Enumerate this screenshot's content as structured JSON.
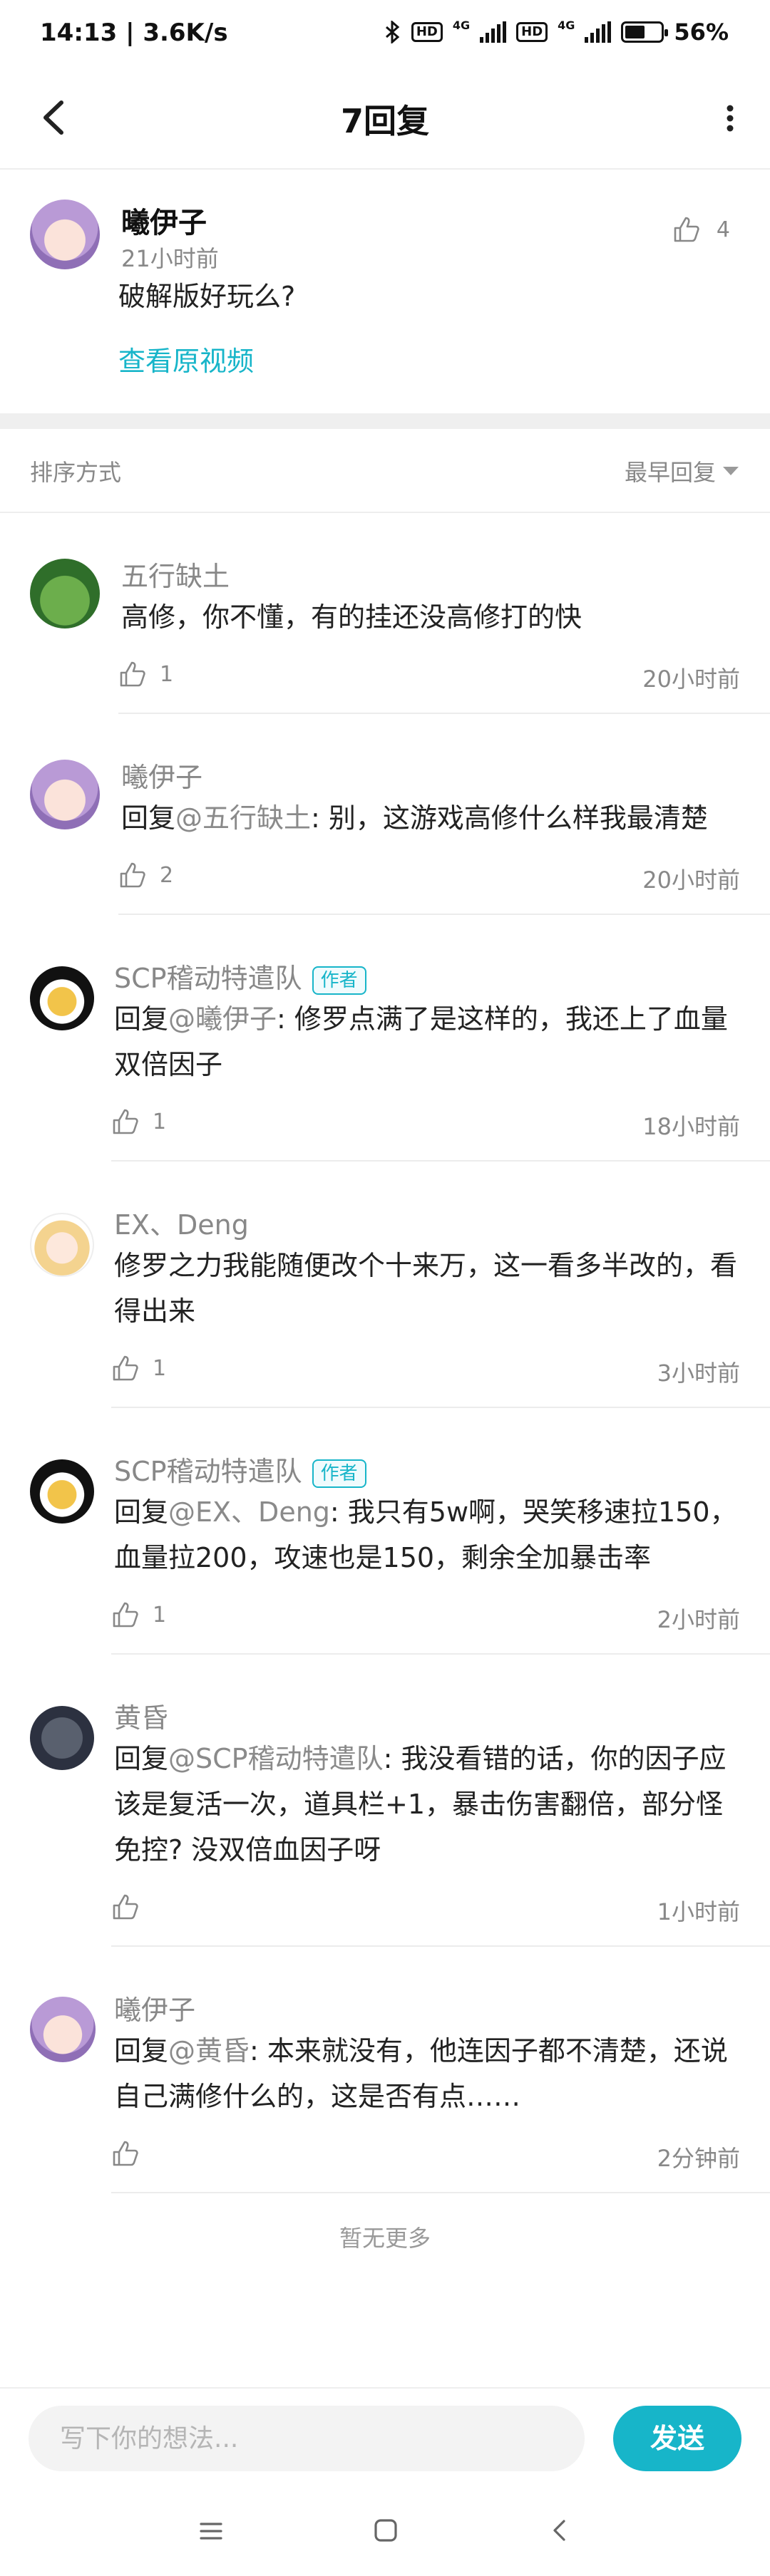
{
  "status_bar": {
    "time": "14:13 | 3.6K/s",
    "battery": "56%",
    "battery_level": 0.56,
    "network_1": "4G",
    "network_2": "4G",
    "hd": "HD"
  },
  "header": {
    "title": "7回复"
  },
  "root_comment": {
    "user": "曦伊子",
    "time": "21小时前",
    "content": "破解版好玩么?",
    "likes": "4",
    "view_video": "查看原视频"
  },
  "sort": {
    "label": "排序方式",
    "selected": "最早回复"
  },
  "replies": [
    {
      "user": "五行缺土",
      "content": "高修，你不懂，有的挂还没高修打的快",
      "likes": "1",
      "time": "20小时前"
    },
    {
      "user": "曦伊子",
      "prefix": "回复",
      "mention": "@五行缺土",
      "content": ": 别，这游戏高修什么样我最清楚",
      "likes": "2",
      "time": "20小时前"
    },
    {
      "user": "SCP稽动特遣队",
      "badge": "作者",
      "prefix": "回复",
      "mention": "@曦伊子",
      "content": ": 修罗点满了是这样的，我还上了血量双倍因子",
      "likes": "1",
      "time": "18小时前"
    },
    {
      "user": "EX、Deng",
      "content": "修罗之力我能随便改个十来万，这一看多半改的，看得出来",
      "likes": "1",
      "time": "3小时前"
    },
    {
      "user": "SCP稽动特遣队",
      "badge": "作者",
      "prefix": "回复",
      "mention": "@EX、Deng",
      "content": ": 我只有5w啊，哭笑移速拉150，血量拉200，攻速也是150，剩余全加暴击率",
      "likes": "1",
      "time": "2小时前"
    },
    {
      "user": "黄昏",
      "prefix": "回复",
      "mention": "@SCP稽动特遣队",
      "content": ": 我没看错的话，你的因子应该是复活一次，道具栏+1，暴击伤害翻倍，部分怪免控? 没双倍血因子呀",
      "likes": "",
      "time": "1小时前"
    },
    {
      "user": "曦伊子",
      "prefix": "回复",
      "mention": "@黄昏",
      "content": ": 本来就没有，他连因子都不清楚，还说自己满修什么的，这是否有点……",
      "likes": "",
      "time": "2分钟前"
    }
  ],
  "footer": {
    "no_more": "暂无更多"
  },
  "composer": {
    "placeholder": "写下你的想法...",
    "send_label": "发送"
  },
  "colors": {
    "accent": "#17b5c9",
    "text": "#222222",
    "muted": "#888888"
  }
}
